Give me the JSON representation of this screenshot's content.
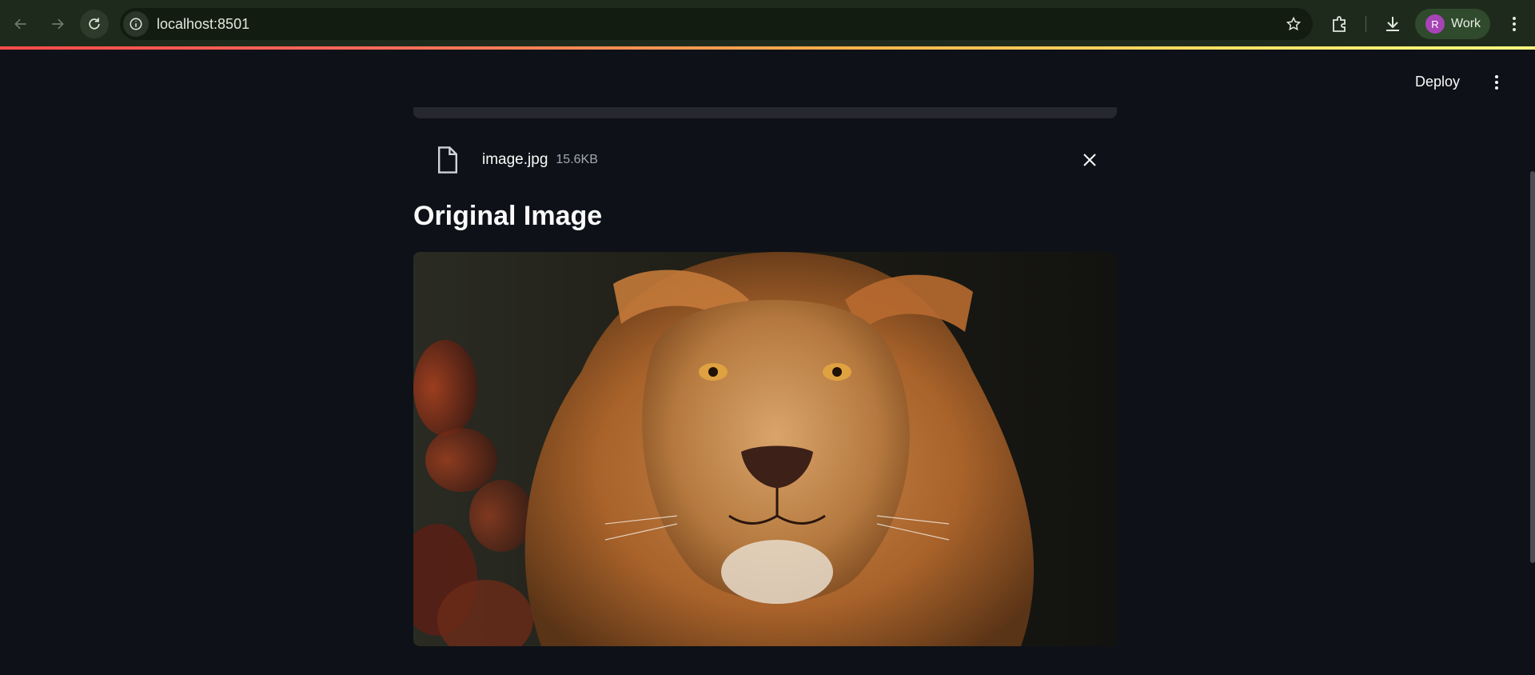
{
  "browser": {
    "url": "localhost:8501",
    "profile": {
      "initial": "R",
      "label": "Work"
    }
  },
  "app": {
    "deploy_label": "Deploy",
    "uploaded_file": {
      "name": "image.jpg",
      "size": "15.6KB"
    },
    "section_title": "Original Image",
    "image_subject": "lion-portrait"
  },
  "colors": {
    "accent_gradient": [
      "#ff4b4b",
      "#ffe264",
      "#fffd80"
    ],
    "app_background": "#0e1117",
    "chrome_background": "#1e2b1c"
  }
}
